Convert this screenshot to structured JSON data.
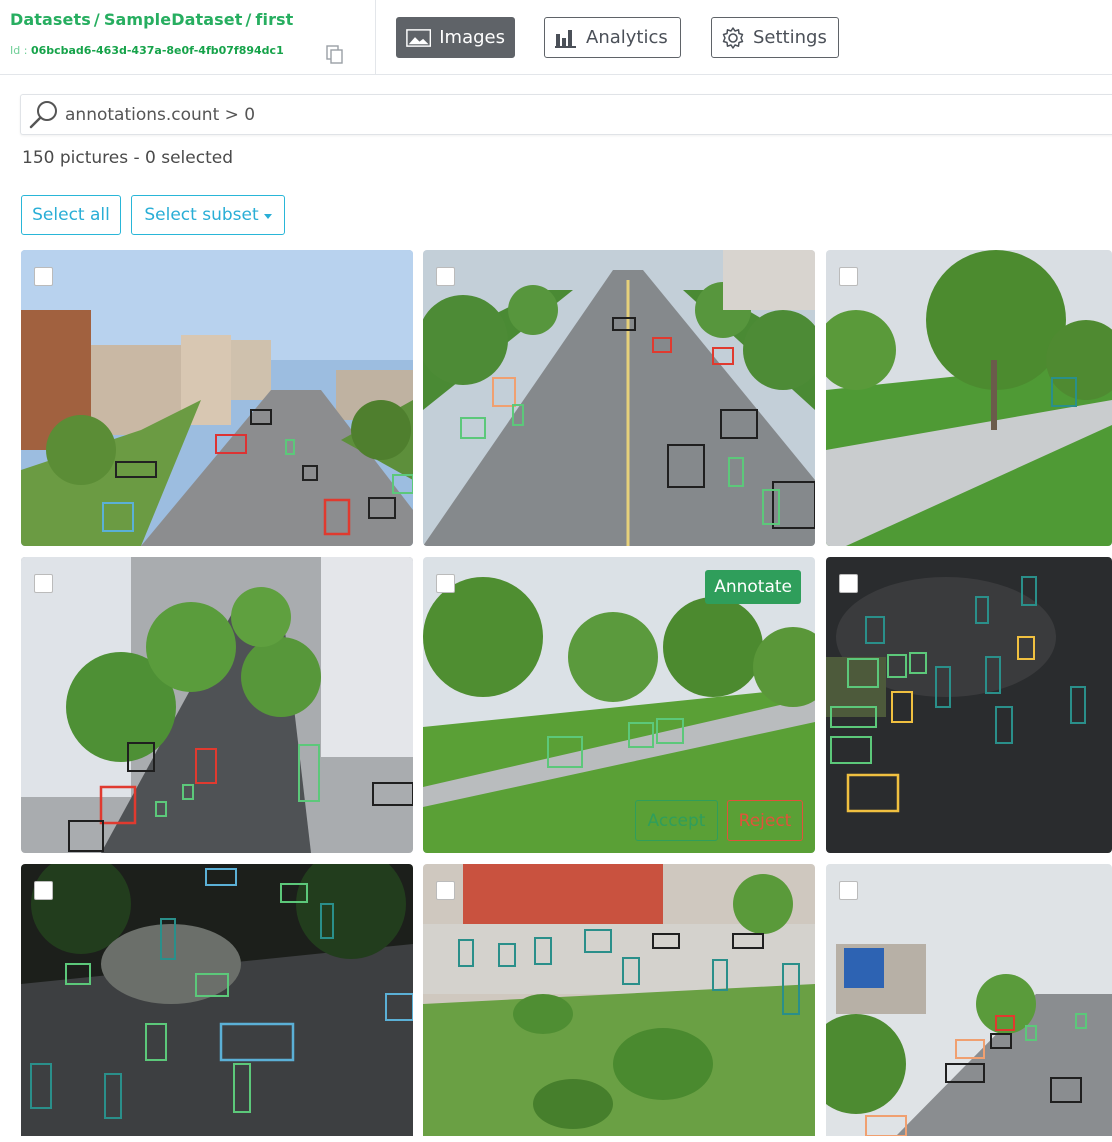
{
  "breadcrumb": {
    "datasets": "Datasets",
    "dataset": "SampleDataset",
    "item": "first",
    "separator": "/"
  },
  "id_line": {
    "label": "Id :",
    "value": "06bcbad6-463d-437a-8e0f-4fb07f894dc1"
  },
  "nav": {
    "images": "Images",
    "analytics": "Analytics",
    "settings": "Settings",
    "active": "Images"
  },
  "search": {
    "query": "annotations.count > 0",
    "placeholder": "Search"
  },
  "summary": {
    "text": "150 pictures - 0 selected"
  },
  "selection": {
    "select_all": "Select all",
    "select_subset": "Select subset"
  },
  "hover_actions": {
    "annotate": "Annotate",
    "accept": "Accept",
    "reject": "Reject"
  },
  "colors": {
    "brand_green": "#27ae60",
    "link_blue": "#29aed6",
    "accept_green": "#2f9e5b",
    "reject_red": "#e0533a",
    "nav_dark": "#5f6368"
  },
  "icons": {
    "search": "search-icon",
    "copy": "copy-icon",
    "images": "image-icon",
    "analytics": "bar-chart-icon",
    "settings": "gear-icon"
  }
}
